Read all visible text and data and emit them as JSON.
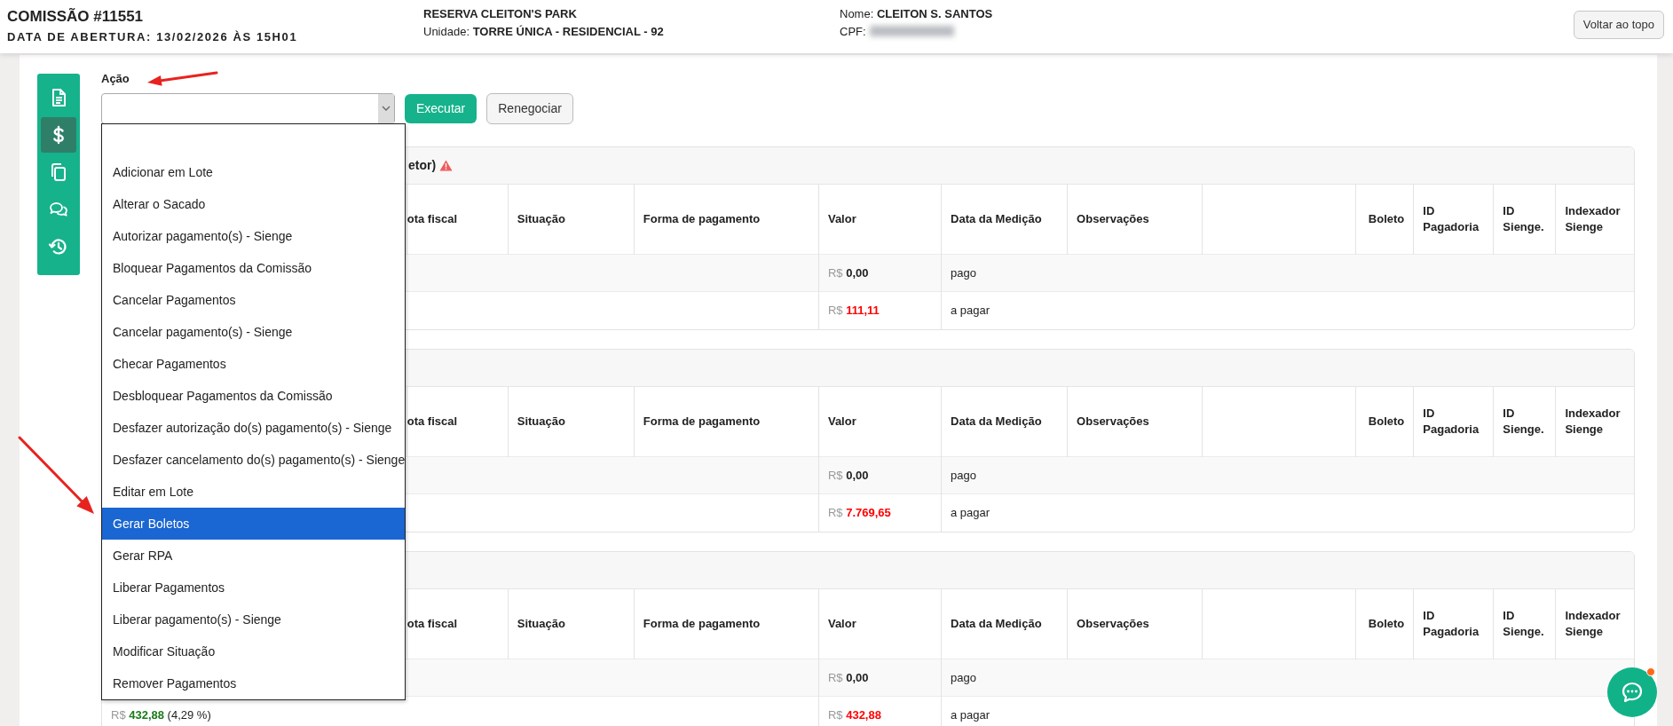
{
  "header": {
    "title": "COMISSÃO #11551",
    "opening_date": "DATA DE ABERTURA: 13/02/2026 ÀS 15H01",
    "reservation": "RESERVA CLEITON'S PARK",
    "unit_label": "Unidade:",
    "unit": "TORRE ÚNICA - RESIDENCIAL - 92",
    "name_label": "Nome:",
    "name": "CLEITON S. SANTOS",
    "cpf_label": "CPF:",
    "cpf_redacted": true,
    "back_to_top_button": "Voltar ao topo"
  },
  "sidebar": {
    "items": [
      {
        "kind": "document",
        "selected": false
      },
      {
        "kind": "dollar",
        "selected": true
      },
      {
        "kind": "copy",
        "selected": false
      },
      {
        "kind": "chat",
        "selected": false
      },
      {
        "kind": "history",
        "selected": false
      }
    ]
  },
  "action": {
    "label": "Ação",
    "select": {
      "expanded": true,
      "options": [
        {
          "label": "Adicionar em Lote",
          "selected": false
        },
        {
          "label": "Alterar o Sacado",
          "selected": false
        },
        {
          "label": "Autorizar pagamento(s) - Sienge",
          "selected": false
        },
        {
          "label": "Bloquear Pagamentos da Comissão",
          "selected": false
        },
        {
          "label": "Cancelar Pagamentos",
          "selected": false
        },
        {
          "label": "Cancelar pagamento(s) - Sienge",
          "selected": false
        },
        {
          "label": "Checar Pagamentos",
          "selected": false
        },
        {
          "label": "Desbloquear Pagamentos da Comissão",
          "selected": false
        },
        {
          "label": "Desfazer autorização do(s) pagamento(s) - Sienge",
          "selected": false
        },
        {
          "label": "Desfazer cancelamento do(s) pagamento(s) - Sienge",
          "selected": false
        },
        {
          "label": "Editar em Lote",
          "selected": false
        },
        {
          "label": "Gerar Boletos",
          "selected": true
        },
        {
          "label": "Gerar RPA",
          "selected": false
        },
        {
          "label": "Liberar Pagamentos",
          "selected": false
        },
        {
          "label": "Liberar pagamento(s) - Sienge",
          "selected": false
        },
        {
          "label": "Modificar Situação",
          "selected": false
        },
        {
          "label": "Remover Pagamentos",
          "selected": false
        }
      ]
    },
    "buttons": [
      {
        "label": "Executar",
        "kind": "primary"
      },
      {
        "label": "Renegociar",
        "kind": "secondary"
      }
    ]
  },
  "cards": [
    {
      "title": "etor)",
      "warning": true,
      "columns": [
        "ota fiscal",
        "Situação",
        "Forma de pagamento",
        "Valor",
        "Data da Medição",
        "Observações",
        "Boleto",
        "ID Pagadoria",
        "ID Sienge.",
        "Indexador Sienge"
      ],
      "rows": [
        {
          "currency": "R$",
          "amount": "0,00",
          "highlight": false,
          "status": "pago"
        },
        {
          "currency": "R$",
          "amount": "111,11",
          "highlight": true,
          "status": "a pagar"
        }
      ]
    },
    {
      "warning": false,
      "columns": [
        "ota fiscal",
        "Situação",
        "Forma de pagamento",
        "Valor",
        "Data da Medição",
        "Observações",
        "Boleto",
        "ID Pagadoria",
        "ID Sienge.",
        "Indexador Sienge"
      ],
      "rows": [
        {
          "currency": "R$",
          "amount": "0,00",
          "highlight": false,
          "status": "pago"
        },
        {
          "currency": "R$",
          "amount": "7.769,65",
          "highlight": true,
          "status": "a pagar"
        }
      ]
    },
    {
      "warning": false,
      "columns": [
        "ota fiscal",
        "Situação",
        "Forma de pagamento",
        "Valor",
        "Data da Medição",
        "Observações",
        "Boleto",
        "ID Pagadoria",
        "ID Sienge.",
        "Indexador Sienge"
      ],
      "rows": [
        {
          "currency": "R$",
          "amount": "0,00",
          "highlight": false,
          "status": "pago"
        },
        {
          "share": {
            "currency": "R$",
            "amount": "432,88",
            "percent": "(4,29 %)"
          },
          "currency": "R$",
          "amount": "432,88",
          "highlight": true,
          "status": "a pagar"
        }
      ]
    }
  ],
  "chat_button": {
    "notification": true
  }
}
